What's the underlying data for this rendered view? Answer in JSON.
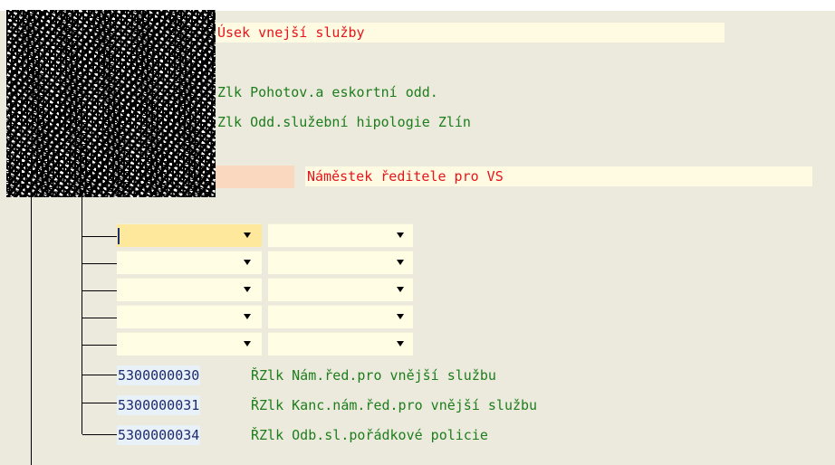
{
  "header": {
    "usek_label": "Úsek vnejší služby"
  },
  "units": [
    {
      "label": "Zlk Pohotov.a eskortní odd."
    },
    {
      "label": "Zlk Odd.služební hipologie Zlín"
    }
  ],
  "deputy": {
    "label": "Náměstek ředitele pro VS"
  },
  "rows": [
    {
      "id": "5300000030",
      "name": "ŘZlk Nám.řed.pro vnější službu"
    },
    {
      "id": "5300000031",
      "name": "ŘZlk Kanc.nám.řed.pro vnější službu"
    },
    {
      "id": "5300000034",
      "name": "ŘZlk Odb.sl.pořádkové policie"
    }
  ],
  "colors": {
    "background": "#eceadc",
    "red_text": "#e8141c",
    "green_text": "#1d7d1d",
    "peach_block": "#fad8c0",
    "active_dropdown": "#fde89c"
  }
}
